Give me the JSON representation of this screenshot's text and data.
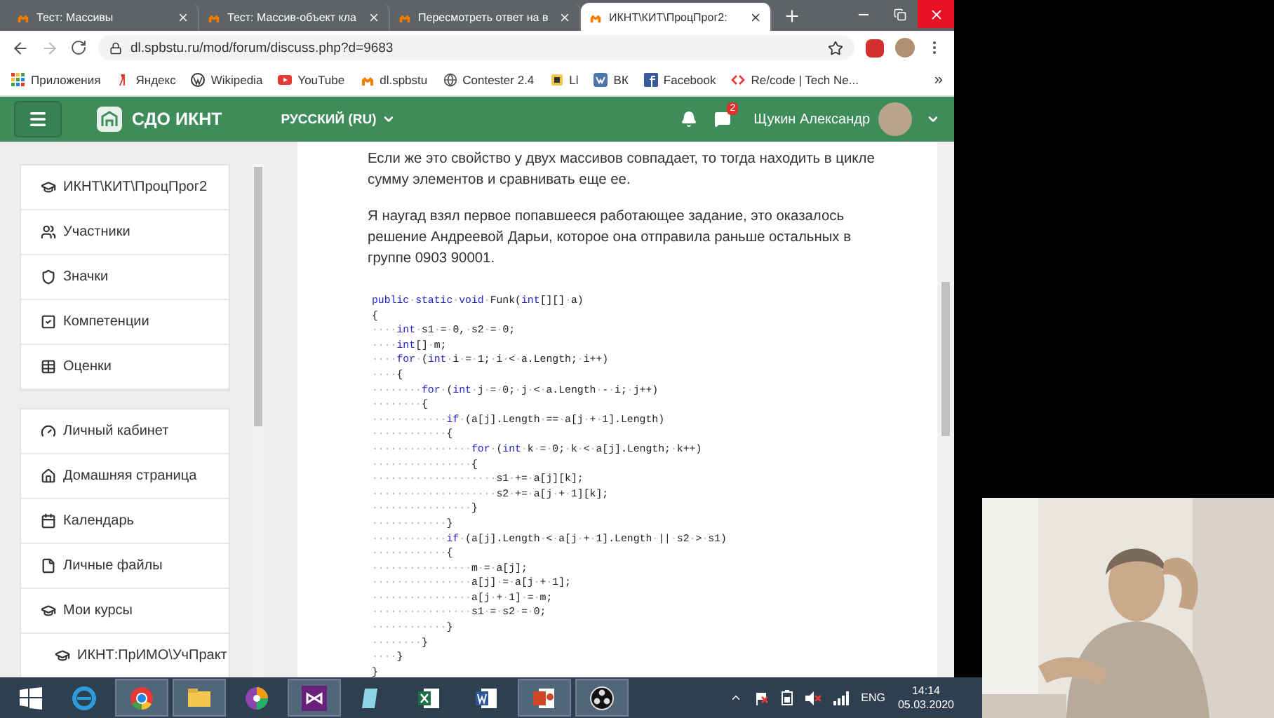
{
  "browser": {
    "tabs": [
      {
        "title": "Тест: Массивы",
        "selected": false
      },
      {
        "title": "Тест: Массив-объект кла",
        "selected": false
      },
      {
        "title": "Пересмотреть ответ на в",
        "selected": false
      },
      {
        "title": "ИКНТ\\КИТ\\ПроцПрог2:",
        "selected": true
      }
    ],
    "url": "dl.spbstu.ru/mod/forum/discuss.php?d=9683",
    "bookmarks": [
      {
        "label": "Приложения",
        "kind": "apps"
      },
      {
        "label": "Яндекс",
        "kind": "yandex"
      },
      {
        "label": "Wikipedia",
        "kind": "wiki"
      },
      {
        "label": "YouTube",
        "kind": "youtube"
      },
      {
        "label": "dl.spbstu",
        "kind": "moodle"
      },
      {
        "label": "Contester 2.4",
        "kind": "globe"
      },
      {
        "label": "Ll",
        "kind": "ll"
      },
      {
        "label": "ВК",
        "kind": "vk"
      },
      {
        "label": "Facebook",
        "kind": "facebook"
      },
      {
        "label": "Re/code | Tech Ne...",
        "kind": "recode"
      }
    ],
    "bookmarks_more": "»"
  },
  "navbar": {
    "site_name": "СДО ИКНТ",
    "language": "РУССКИЙ (RU)",
    "message_badge": "2",
    "user_name": "Щукин Александр"
  },
  "sidebar": {
    "groups": [
      {
        "items": [
          {
            "label": "ИКНТ\\КИТ\\ПроцПрог2",
            "kind": "course"
          },
          {
            "label": "Участники",
            "kind": "participants"
          },
          {
            "label": "Значки",
            "kind": "badges"
          },
          {
            "label": "Компетенции",
            "kind": "competencies"
          },
          {
            "label": "Оценки",
            "kind": "grades"
          }
        ]
      },
      {
        "items": [
          {
            "label": "Личный кабинет",
            "kind": "dashboard"
          },
          {
            "label": "Домашняя страница",
            "kind": "home"
          },
          {
            "label": "Календарь",
            "kind": "calendar"
          },
          {
            "label": "Личные файлы",
            "kind": "files"
          },
          {
            "label": "Мои курсы",
            "kind": "course",
            "children": [
              {
                "label": "ИКНТ:ПрИМО\\УчПракт",
                "kind": "course"
              }
            ]
          }
        ]
      }
    ]
  },
  "post": {
    "paragraphs": [
      "Если же это свойство у двух массивов совпадает, то тогда находить в цикле сумму элементов и сравнивать еще ее.",
      "Я наугад взял первое попавшееся работающее задание, это оказалось решение Андреевой Дарьи, которое она отправила раньше остальных в группе 0903 90001."
    ],
    "code_lines": [
      "public·static·void·Funk(int[][]·a)",
      "{",
      "····int·s1·=·0,·s2·=·0;",
      "····int[]·m;",
      "····for·(int·i·=·1;·i·<·a.Length;·i++)",
      "····{",
      "········for·(int·j·=·0;·j·<·a.Length·-·i;·j++)",
      "········{",
      "············if·(a[j].Length·==·a[j·+·1].Length)",
      "············{",
      "················for·(int·k·=·0;·k·<·a[j].Length;·k++)",
      "················{",
      "····················s1·+=·a[j][k];",
      "····················s2·+=·a[j·+·1][k];",
      "················}",
      "············}",
      "············if·(a[j].Length·<·a[j·+·1].Length·||·s2·>·s1)",
      "············{",
      "················m·=·a[j];",
      "················a[j]·=·a[j·+·1];",
      "················a[j·+·1]·=·m;",
      "················s1·=·s2·=·0;",
      "············}",
      "········}",
      "····}",
      "}"
    ]
  },
  "taskbar": {
    "apps": [
      {
        "kind": "ie",
        "active": false
      },
      {
        "kind": "chrome",
        "active": true
      },
      {
        "kind": "explorer",
        "active": true
      },
      {
        "kind": "picasa",
        "active": false
      },
      {
        "kind": "vs",
        "active": true
      },
      {
        "kind": "notes",
        "active": false
      },
      {
        "kind": "excel",
        "active": false
      },
      {
        "kind": "word",
        "active": false
      },
      {
        "kind": "powerpoint",
        "active": true
      },
      {
        "kind": "obs",
        "active": true
      }
    ],
    "language": "ENG",
    "time": "14:14",
    "date": "05.03.2020"
  }
}
